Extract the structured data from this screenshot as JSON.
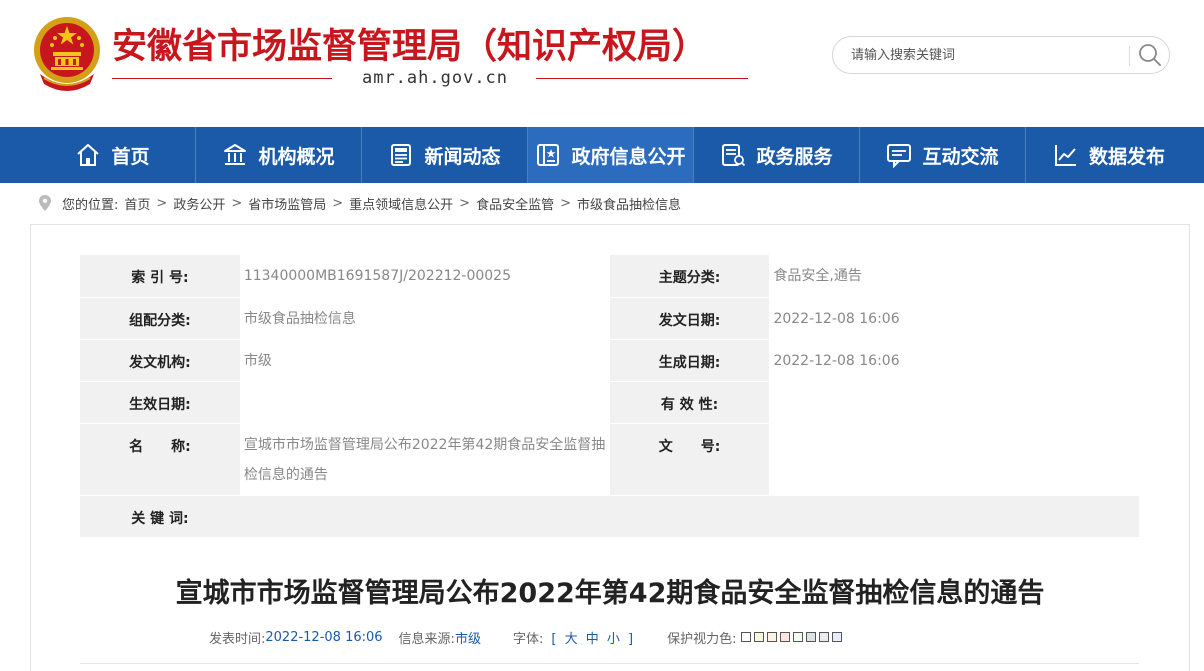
{
  "header": {
    "site_title": "安徽省市场监督管理局（知识产权局）",
    "domain": "amr.ah.gov.cn",
    "search_placeholder": "请输入搜索关键词"
  },
  "nav": [
    {
      "label": "首页",
      "icon": "home-icon"
    },
    {
      "label": "机构概况",
      "icon": "building-icon"
    },
    {
      "label": "新闻动态",
      "icon": "news-icon"
    },
    {
      "label": "政府信息公开",
      "icon": "document-icon",
      "active": true
    },
    {
      "label": "政务服务",
      "icon": "service-icon"
    },
    {
      "label": "互动交流",
      "icon": "chat-icon"
    },
    {
      "label": "数据发布",
      "icon": "chart-icon"
    }
  ],
  "breadcrumb": {
    "prefix": "您的位置:",
    "items": [
      "首页",
      "政务公开",
      "省市场监管局",
      "重点领域信息公开",
      "食品安全监管",
      "市级食品抽检信息"
    ],
    "separator": ">"
  },
  "meta": {
    "index_no_label": "索 引 号:",
    "index_no": "11340000MB1691587J/202212-00025",
    "topic_label": "主题分类:",
    "topic": "食品安全,通告",
    "category_label": "组配分类:",
    "category": "市级食品抽检信息",
    "issue_date_label": "发文日期:",
    "issue_date": "2022-12-08 16:06",
    "issuer_label": "发文机构:",
    "issuer": "市级",
    "created_date_label": "生成日期:",
    "created_date": "2022-12-08 16:06",
    "effective_label": "生效日期:",
    "effective": "",
    "validity_label": "有 效 性:",
    "validity": "",
    "name_label": "名　　称:",
    "name": "宣城市市场监督管理局公布2022年第42期食品安全监督抽检信息的通告",
    "doc_no_label": "文　　号:",
    "doc_no": "",
    "keywords_label": "关 键 词:",
    "keywords": ""
  },
  "article": {
    "title": "宣城市市场监督管理局公布2022年第42期食品安全监督抽检信息的通告",
    "publish_label": "发表时间:",
    "publish_time": "2022-12-08 16:06",
    "source_label": "信息来源:",
    "source": "市级",
    "font_label": "字体:",
    "font_open": "[",
    "font_large": "大",
    "font_medium": "中",
    "font_small": "小",
    "font_close": "]",
    "eye_label": "保护视力色:",
    "eye_colors": [
      "#ffffff",
      "#faf9de",
      "#fff2e2",
      "#fde6e0",
      "#f3fff1",
      "#dae3e8",
      "#eaeaef",
      "#e9ebfe"
    ]
  },
  "colors": {
    "brand_red": "#c8161d",
    "nav_blue": "#1b5aa8",
    "nav_active": "#2c6cbf"
  }
}
